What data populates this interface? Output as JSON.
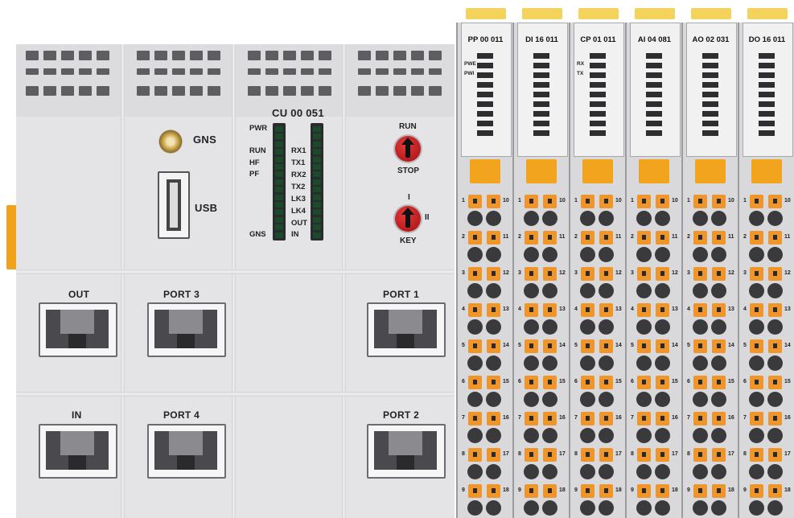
{
  "cpu": {
    "model": "CU 00 051",
    "gns_label": "GNS",
    "usb_label": "USB",
    "led_left_labels": [
      "PWR",
      "RUN",
      "HF",
      "PF",
      "GNS"
    ],
    "led_right_labels": [
      "RX1",
      "TX1",
      "RX2",
      "TX2",
      "LK3",
      "LK4",
      "OUT",
      "IN"
    ],
    "run_label": "RUN",
    "stop_label": "STOP",
    "key_label": "KEY",
    "key_pos_1": "I",
    "key_pos_2": "II",
    "ports": {
      "out": "OUT",
      "in": "IN",
      "port3": "PORT 3",
      "port4": "PORT 4",
      "port1": "PORT 1",
      "port2": "PORT 2"
    }
  },
  "modules": [
    {
      "name": "PP 00 011",
      "leds": [
        "PWE",
        "PWI"
      ]
    },
    {
      "name": "DI 16 011",
      "leds": []
    },
    {
      "name": "CP 01 011",
      "leds": [
        "RX",
        "TX"
      ]
    },
    {
      "name": "AI 04 081",
      "leds": []
    },
    {
      "name": "AO 02 031",
      "leds": []
    },
    {
      "name": "DO 16 011",
      "leds": []
    }
  ],
  "terminal_numbers_left": [
    "1",
    "2",
    "3",
    "4",
    "5",
    "6",
    "7",
    "8",
    "9"
  ],
  "terminal_numbers_right": [
    "10",
    "11",
    "12",
    "13",
    "14",
    "15",
    "16",
    "17",
    "18"
  ],
  "colors": {
    "housing": "#e4e4e6",
    "terminal": "#f0952a",
    "tab": "#f3d35c",
    "knob": "#c41a1e"
  }
}
